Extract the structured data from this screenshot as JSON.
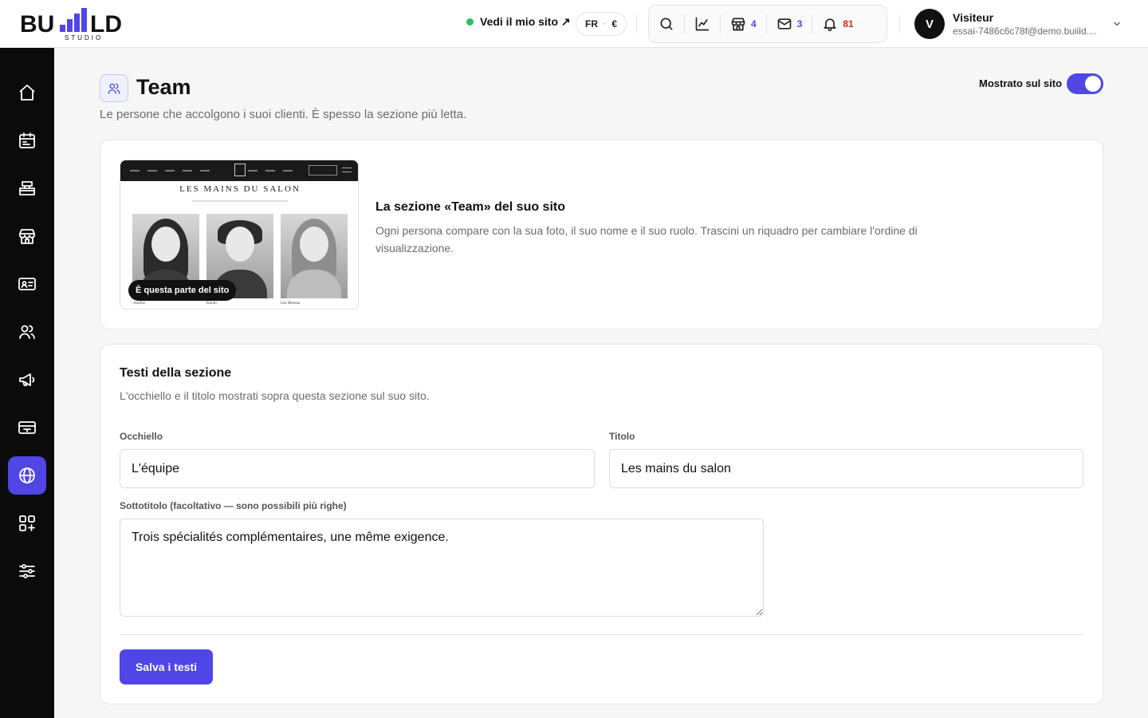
{
  "brand": {
    "logo_text": "BU LD",
    "logo_sub": "STUDIO"
  },
  "topbar": {
    "site_link": "Vedi il mio sito ↗",
    "lang": "FR",
    "currency": "€",
    "counts": {
      "shop": "4",
      "mail": "3",
      "notifications": "81"
    }
  },
  "user": {
    "initial": "V",
    "name": "Visiteur",
    "email": "essai-7486c6c78f@demo.buiild...."
  },
  "sidebar": {
    "items": [
      "home-icon",
      "calendar-icon",
      "register-icon",
      "store-icon",
      "id-card-icon",
      "team-icon",
      "megaphone-icon",
      "card-icon",
      "globe-icon",
      "apps-icon",
      "sliders-icon"
    ],
    "active_index": 8
  },
  "page": {
    "title": "Team",
    "subtitle": "Le persone che accolgono i suoi clienti. È spesso la sezione più letta.",
    "toggle_label": "Mostrato sul sito",
    "toggle_on": true
  },
  "preview_card": {
    "mini_title": "LES MAINS DU SALON",
    "names": [
      "Aurélie",
      "Karim",
      "Léa Moreau"
    ],
    "badge": "È questa parte del sito",
    "title": "La sezione «Team» del suo sito",
    "text": "Ogni persona compare con la sua foto, il suo nome e il suo ruolo. Trascini un riquadro per cambiare l'ordine di visualizzazione."
  },
  "texts_card": {
    "title": "Testi della sezione",
    "subtitle": "L'occhiello e il titolo mostrati sopra questa sezione sul suo sito.",
    "eyebrow_label": "Occhiello",
    "eyebrow_value": "L'équipe",
    "title_label": "Titolo",
    "title_value": "Les mains du salon",
    "subtitle_label": "Sottotitolo (facoltativo — sono possibili più righe)",
    "subtitle_value": "Trois spécialités complémentaires, une même exigence.",
    "save_label": "Salva i testi"
  },
  "colors": {
    "accent": "#4f46e5",
    "status_green": "#22c55e",
    "alert_red": "#dc2626",
    "sidebar_bg": "#0b0b0c"
  }
}
